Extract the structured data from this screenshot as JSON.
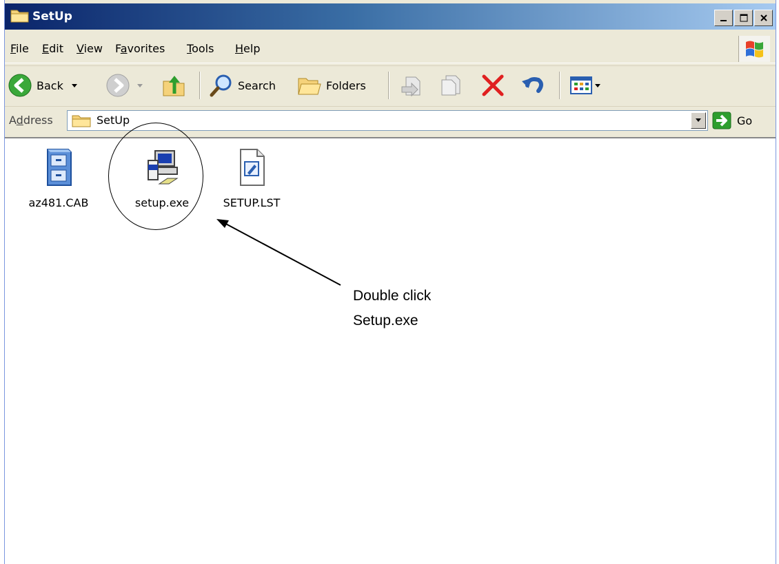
{
  "window": {
    "title": "SetUp"
  },
  "menu": [
    {
      "pre": "",
      "acc": "F",
      "post": "ile"
    },
    {
      "pre": "",
      "acc": "E",
      "post": "dit"
    },
    {
      "pre": "",
      "acc": "V",
      "post": "iew"
    },
    {
      "pre": "F",
      "acc": "a",
      "post": "vorites"
    },
    {
      "pre": "",
      "acc": "T",
      "post": "ools"
    },
    {
      "pre": "",
      "acc": "H",
      "post": "elp"
    }
  ],
  "toolbar": {
    "back_label": "Back",
    "search_label": "Search",
    "folders_label": "Folders"
  },
  "address": {
    "label_pre": "A",
    "label_acc": "d",
    "label_post": "dress",
    "value": "SetUp",
    "go_label": "Go"
  },
  "files": [
    {
      "name": "az481.CAB",
      "icon": "cabinet-icon"
    },
    {
      "name": "setup.exe",
      "icon": "installer-icon"
    },
    {
      "name": "SETUP.LST",
      "icon": "document-icon"
    }
  ],
  "annotation": {
    "line1": "Double click",
    "line2": "Setup.exe"
  },
  "colors": {
    "titlebar_start": "#0a246a",
    "titlebar_end": "#a6caf0",
    "chrome": "#ece9d8",
    "go_green": "#2e9e2e",
    "delete_red": "#e02020"
  }
}
